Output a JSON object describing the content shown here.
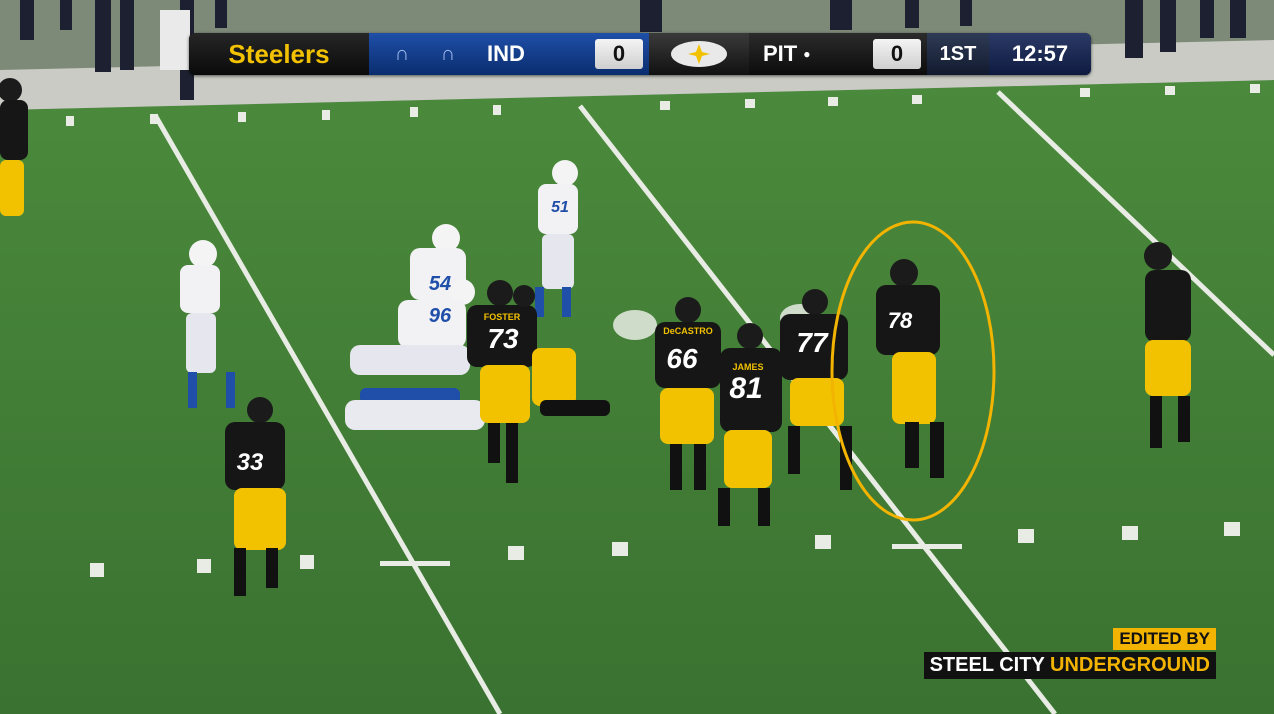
{
  "scorebug": {
    "brand": "Steelers",
    "away_abbr": "IND",
    "away_score": "0",
    "home_abbr": "PIT",
    "home_score": "0",
    "quarter": "1ST",
    "clock": "12:57"
  },
  "players": [
    {
      "number": "73",
      "name": "FOSTER"
    },
    {
      "number": "66",
      "name": "DeCASTRO"
    },
    {
      "number": "81",
      "name": "JAMES"
    },
    {
      "number": "77",
      "name": ""
    },
    {
      "number": "78",
      "name": ""
    },
    {
      "number": "33",
      "name": ""
    },
    {
      "number": "54",
      "name": ""
    },
    {
      "number": "96",
      "name": ""
    },
    {
      "number": "51",
      "name": ""
    }
  ],
  "watermark": {
    "line1": "EDITED BY",
    "line2_a": "STEEL CITY ",
    "line2_b": "UNDERGROUND"
  },
  "colors": {
    "field_green": "#3f7a35",
    "steelers_gold": "#f2c200",
    "colts_blue": "#1f4fa8",
    "highlight_circle": "#f2b400"
  }
}
